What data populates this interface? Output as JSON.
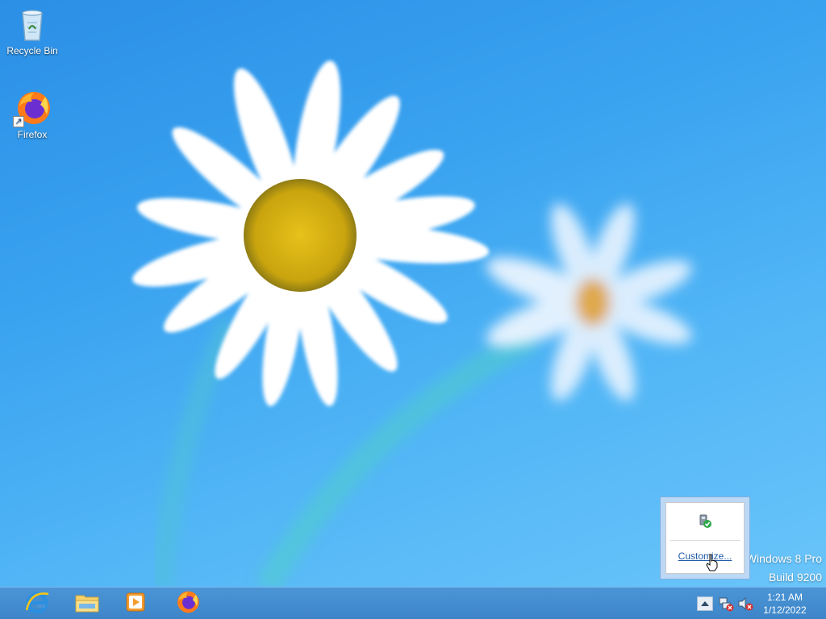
{
  "desktop": {
    "icons": [
      {
        "label": "Recycle Bin",
        "icon": "recycle-bin-icon"
      },
      {
        "label": "Firefox",
        "icon": "firefox-icon"
      }
    ],
    "watermark": {
      "edition": "Windows 8 Pro",
      "build": "Build 9200"
    }
  },
  "tray_popup": {
    "icons": [
      "usb-safely-remove-icon"
    ],
    "customize_label": "Customize..."
  },
  "taskbar": {
    "pinned": [
      {
        "name": "Internet Explorer",
        "icon": "internet-explorer-icon"
      },
      {
        "name": "File Explorer",
        "icon": "file-explorer-icon"
      },
      {
        "name": "Windows Media Player",
        "icon": "media-player-icon"
      },
      {
        "name": "Firefox",
        "icon": "firefox-icon"
      }
    ],
    "tray": {
      "icons": [
        "show-hidden-icons-chevron",
        "network-disconnected-icon",
        "volume-muted-icon"
      ],
      "time": "1:21 AM",
      "date": "1/12/2022"
    }
  },
  "colors": {
    "taskbar": "#3d85c8",
    "desktop_sky": "#3aa3f0",
    "link": "#1e5aa8"
  }
}
